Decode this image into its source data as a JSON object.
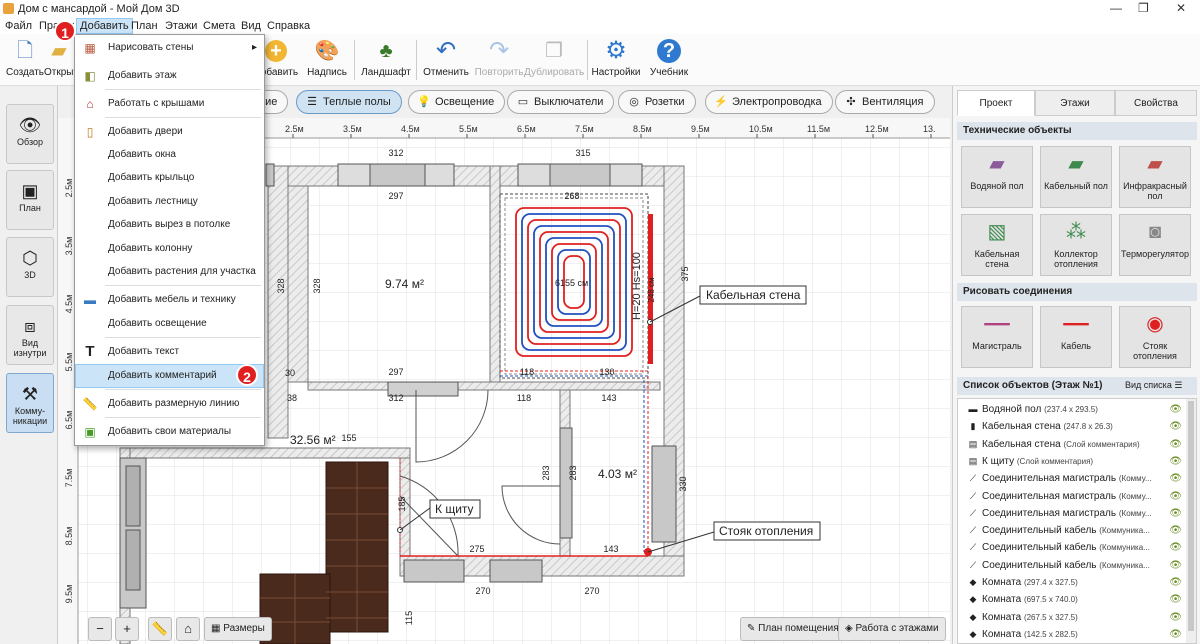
{
  "window": {
    "title": "Дом с мансардой - Мой Дом 3D",
    "controls": [
      "—",
      "❐",
      "✕"
    ]
  },
  "menu": [
    "Файл",
    "Правка",
    "Добавить",
    "План",
    "Этажи",
    "Смета",
    "Вид",
    "Справка"
  ],
  "toolbar": [
    {
      "label": "Создать",
      "icon": "new-file-icon"
    },
    {
      "label": "Открыть",
      "icon": "open-folder-icon"
    },
    {
      "label": "Добавить",
      "icon": "add-icon"
    },
    {
      "label": "Надпись",
      "icon": "paint-palette-icon"
    },
    {
      "label": "Ландшафт",
      "icon": "tree-icon"
    },
    {
      "label": "Отменить",
      "icon": "undo-icon"
    },
    {
      "label": "Повторить",
      "icon": "redo-icon",
      "disabled": true
    },
    {
      "label": "Дублировать",
      "icon": "duplicate-icon",
      "disabled": true
    },
    {
      "label": "Настройки",
      "icon": "gear-icon"
    },
    {
      "label": "Учебник",
      "icon": "help-icon"
    }
  ],
  "leftnav": [
    {
      "label": "Обзор",
      "icon": "eye-icon"
    },
    {
      "label": "План",
      "icon": "plan-icon"
    },
    {
      "label": "3D",
      "icon": "cube-icon"
    },
    {
      "label": "Вид изнутри",
      "icon": "inside-view-icon"
    },
    {
      "label": "Комму-никации",
      "icon": "pipe-icon",
      "active": true
    }
  ],
  "filters": [
    {
      "label": "ние",
      "icon": ""
    },
    {
      "label": "Теплые полы",
      "icon": "floor-heating-icon",
      "active": true
    },
    {
      "label": "Освещение",
      "icon": "bulb-icon"
    },
    {
      "label": "Выключатели",
      "icon": "switch-icon"
    },
    {
      "label": "Розетки",
      "icon": "socket-icon"
    },
    {
      "label": "Электропроводка",
      "icon": "lightning-icon"
    },
    {
      "label": "Вентиляция",
      "icon": "fan-icon"
    }
  ],
  "dropdown": [
    {
      "label": "Нарисовать стены",
      "icon": "brick-wall-icon",
      "submenu": true
    },
    {
      "label": "Добавить этаж",
      "icon": "floor-icon"
    },
    {
      "label": "Работать с крышами",
      "icon": "roof-icon"
    },
    {
      "label": "Добавить двери",
      "icon": "door-icon"
    },
    {
      "label": "Добавить окна",
      "icon": ""
    },
    {
      "label": "Добавить крыльцо",
      "icon": ""
    },
    {
      "label": "Добавить лестницу",
      "icon": ""
    },
    {
      "label": "Добавить вырез в потолке",
      "icon": ""
    },
    {
      "label": "Добавить колонну",
      "icon": ""
    },
    {
      "label": "Добавить растения для участка",
      "icon": ""
    },
    {
      "label": "Добавить мебель и технику",
      "icon": "sofa-icon"
    },
    {
      "label": "Добавить освещение",
      "icon": ""
    },
    {
      "label": "Добавить текст",
      "icon": "text-icon"
    },
    {
      "label": "Добавить комментарий",
      "icon": "",
      "active": true
    },
    {
      "label": "Добавить размерную линию",
      "icon": "ruler-icon"
    },
    {
      "label": "Добавить свои материалы",
      "icon": "materials-icon"
    }
  ],
  "badges": [
    "1",
    "2"
  ],
  "ruler_top": [
    "2.5м",
    "3.5м",
    "4.5м",
    "5.5м",
    "6.5м",
    "7.5м",
    "8.5м",
    "9.5м",
    "10.5м",
    "11.5м",
    "12.5м",
    "13."
  ],
  "ruler_left": [
    "2.5м",
    "3.5м",
    "4.5м",
    "5.5м",
    "6.5м",
    "7.5м",
    "8.5м",
    "9.5м"
  ],
  "plan": {
    "dims": [
      "312",
      "315",
      "297",
      "268",
      "328",
      "328",
      "375",
      "30",
      "297",
      "118",
      "130",
      "38",
      "312",
      "118",
      "143",
      "155",
      "283",
      "283",
      "330",
      "185",
      "275",
      "143",
      "270",
      "270",
      "115"
    ],
    "rooms": [
      "9.74 м²",
      "32.56 м²",
      "4.03 м²"
    ],
    "heating_center": "6155 см",
    "heating_vertical": "H=20 Hs=100",
    "heating_side": "248 см",
    "callouts": [
      "Кабельная стена",
      "К щиту",
      "Стояк отопления"
    ]
  },
  "bottom": {
    "zoom_out": "−",
    "zoom_in": "+",
    "sizes": "Размеры",
    "room_plan": "План помещения",
    "floors_work": "Работа с этажами"
  },
  "right": {
    "tabs": [
      "Проект",
      "Этажи",
      "Свойства"
    ],
    "tech_header": "Технические объекты",
    "tech_tiles": [
      {
        "label": "Водяной пол",
        "icon": "water-floor-icon",
        "color": "#8a5a9a"
      },
      {
        "label": "Кабельный пол",
        "icon": "cable-floor-icon",
        "color": "#3e8a4e"
      },
      {
        "label": "Инфракрасный пол",
        "icon": "infrared-floor-icon",
        "color": "#c0504d"
      },
      {
        "label": "Кабельная стена",
        "icon": "cable-wall-icon",
        "color": "#3e8a4e"
      },
      {
        "label": "Коллектор отопления",
        "icon": "collector-icon",
        "color": "#3e8a4e"
      },
      {
        "label": "Терморегулятор",
        "icon": "thermostat-icon",
        "color": "#888888"
      }
    ],
    "conn_header": "Рисовать соединения",
    "conn_tiles": [
      {
        "label": "Магистраль",
        "icon": "main-line-icon"
      },
      {
        "label": "Кабель",
        "icon": "cable-icon"
      },
      {
        "label": "Стояк отопления",
        "icon": "riser-icon"
      }
    ],
    "list_header": "Список объектов (Этаж №1)",
    "list_view": "Вид списка",
    "objects": [
      {
        "name": "Водяной пол",
        "detail": "(237.4 x 293.5)",
        "icon": "▬"
      },
      {
        "name": "Кабельная стена",
        "detail": "(247.8 x 26.3)",
        "icon": "▮"
      },
      {
        "name": "Кабельная стена",
        "detail": "(Слой комментария)",
        "icon": "▤"
      },
      {
        "name": "К щиту",
        "detail": "(Слой комментария)",
        "icon": "▤"
      },
      {
        "name": "Соединительная магистраль",
        "detail": "(Комму...",
        "icon": "⟋"
      },
      {
        "name": "Соединительная магистраль",
        "detail": "(Комму...",
        "icon": "⟋"
      },
      {
        "name": "Соединительная магистраль",
        "detail": "(Комму...",
        "icon": "⟋"
      },
      {
        "name": "Соединительный кабель",
        "detail": "(Коммуника...",
        "icon": "⟋"
      },
      {
        "name": "Соединительный кабель",
        "detail": "(Коммуника...",
        "icon": "⟋"
      },
      {
        "name": "Соединительный кабель",
        "detail": "(Коммуника...",
        "icon": "⟋"
      },
      {
        "name": "Комната",
        "detail": "(297.4 x 327.5)",
        "icon": "◆"
      },
      {
        "name": "Комната",
        "detail": "(697.5 x 740.0)",
        "icon": "◆"
      },
      {
        "name": "Комната",
        "detail": "(267.5 x 327.5)",
        "icon": "◆"
      },
      {
        "name": "Комната",
        "detail": "(142.5 x 282.5)",
        "icon": "◆"
      }
    ]
  }
}
